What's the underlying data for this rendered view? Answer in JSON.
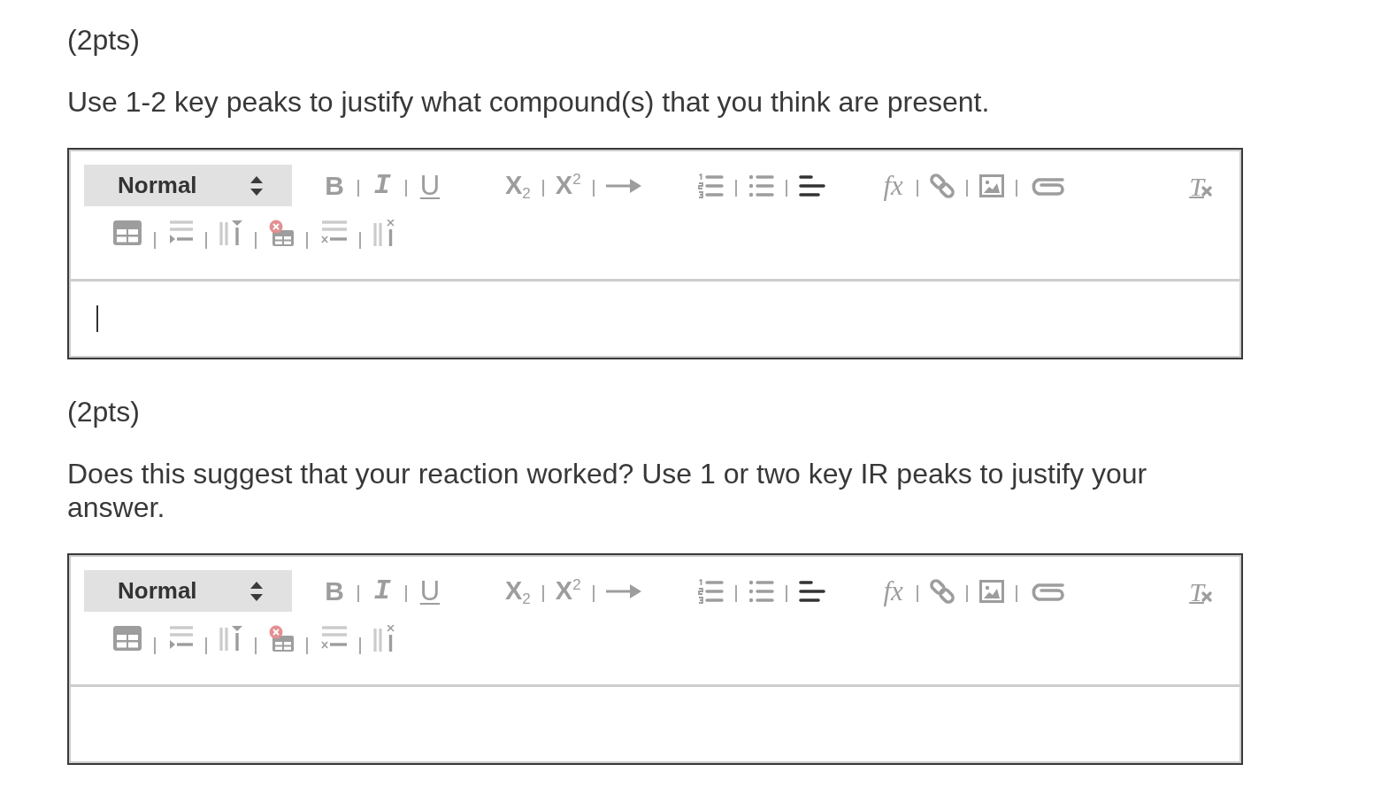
{
  "questions": [
    {
      "points": "(2pts)",
      "prompt": "Use 1-2 key peaks to justify what compound(s) that you think are present.",
      "editor": {
        "format": "Normal",
        "focused": true,
        "toolbar": [
          [
            [
              {
                "kind": "bold",
                "label": "B",
                "active": false
              },
              {
                "kind": "italic",
                "label": "I",
                "active": false
              },
              {
                "kind": "underline",
                "label": "U",
                "active": false
              }
            ],
            [
              {
                "kind": "subscript",
                "label": "X$_{2}$",
                "active": false
              },
              {
                "kind": "superscript",
                "label": "X$^{2}$",
                "active": false
              },
              {
                "kind": "arrow",
                "active": false
              }
            ],
            [
              {
                "kind": "ordered_list",
                "active": false
              },
              {
                "kind": "bullet_list",
                "active": false
              },
              {
                "kind": "align_left",
                "active": true
              }
            ],
            [
              {
                "kind": "formula",
                "label": "fx",
                "active": false
              },
              {
                "kind": "link",
                "active": false
              },
              {
                "kind": "image",
                "active": false
              },
              {
                "kind": "attach",
                "active": false
              }
            ],
            [
              {
                "kind": "clean",
                "label": "T",
                "active": false
              }
            ]
          ],
          [
            [
              {
                "kind": "table",
                "active": false
              },
              {
                "kind": "insert_row",
                "active": false
              },
              {
                "kind": "insert_column",
                "active": false
              },
              {
                "kind": "delete_table",
                "active": false
              },
              {
                "kind": "delete_row",
                "active": false
              },
              {
                "kind": "delete_column",
                "active": false
              }
            ]
          ]
        ]
      }
    },
    {
      "points": "(2pts)",
      "prompt": "Does this suggest that your reaction worked? Use 1 or two key IR peaks to justify your answer.",
      "editor": {
        "format": "Normal",
        "focused": false,
        "toolbar": [
          [
            [
              {
                "kind": "bold",
                "label": "B",
                "active": false
              },
              {
                "kind": "italic",
                "label": "I",
                "active": false
              },
              {
                "kind": "underline",
                "label": "U",
                "active": false
              }
            ],
            [
              {
                "kind": "subscript",
                "label": "X$_{2}$",
                "active": false
              },
              {
                "kind": "superscript",
                "label": "X$^{2}$",
                "active": false
              },
              {
                "kind": "arrow",
                "active": false
              }
            ],
            [
              {
                "kind": "ordered_list",
                "active": false
              },
              {
                "kind": "bullet_list",
                "active": false
              },
              {
                "kind": "align_left",
                "active": true
              }
            ],
            [
              {
                "kind": "formula",
                "label": "fx",
                "active": false
              },
              {
                "kind": "link",
                "active": false
              },
              {
                "kind": "image",
                "active": false
              },
              {
                "kind": "attach",
                "active": false
              }
            ],
            [
              {
                "kind": "clean",
                "label": "T",
                "active": false
              }
            ]
          ],
          [
            [
              {
                "kind": "table",
                "active": false
              },
              {
                "kind": "insert_row",
                "active": false
              },
              {
                "kind": "insert_column",
                "active": false
              },
              {
                "kind": "delete_table",
                "active": false
              },
              {
                "kind": "delete_row",
                "active": false
              },
              {
                "kind": "delete_column",
                "active": false
              }
            ]
          ]
        ]
      }
    }
  ]
}
